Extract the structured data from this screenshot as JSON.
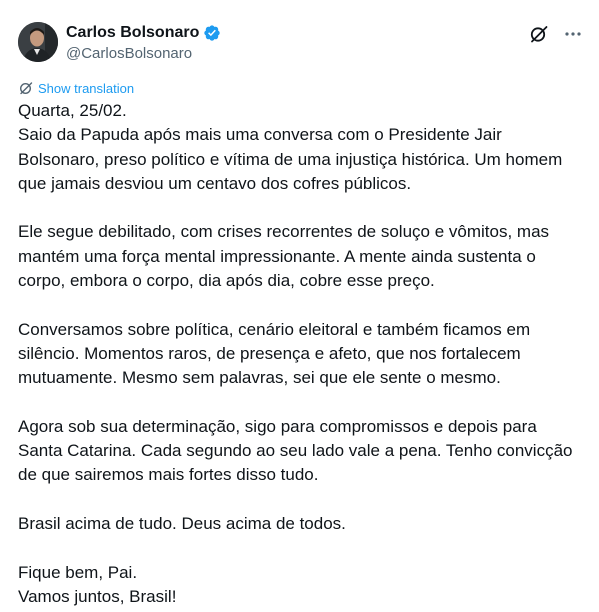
{
  "author": {
    "display_name": "Carlos Bolsonaro",
    "handle": "@CarlosBolsonaro",
    "verified": true
  },
  "icons": {
    "avatar": "avatar-photo",
    "verified": "verified-badge-icon",
    "grok": "grok-icon",
    "more": "more-options-icon",
    "translate": "translate-icon"
  },
  "colors": {
    "accent": "#1d9bf0",
    "text": "#0f1419",
    "secondary": "#536471"
  },
  "translation": {
    "label": "Show translation"
  },
  "post": {
    "paragraphs": [
      {
        "lines": [
          "Quarta, 25/02.",
          "Saio da Papuda após mais uma conversa com o Presidente Jair",
          "Bolsonaro, preso político e vítima de uma injustiça histórica. Um homem",
          "que jamais desviou um centavo dos cofres públicos."
        ]
      },
      {
        "lines": [
          "Ele segue debilitado, com crises recorrentes de soluço e vômitos, mas",
          "mantém uma força mental impressionante. A mente ainda sustenta o",
          "corpo, embora o corpo, dia após dia, cobre esse preço."
        ]
      },
      {
        "lines": [
          "Conversamos sobre política, cenário eleitoral e também ficamos em",
          "silêncio. Momentos raros, de presença e afeto, que nos fortalecem",
          "mutuamente. Mesmo sem palavras, sei que ele sente o mesmo."
        ]
      },
      {
        "lines": [
          "Agora sob sua determinação, sigo para compromissos e depois para",
          "Santa Catarina. Cada segundo ao seu lado vale a pena. Tenho convicção",
          "de que sairemos mais fortes disso tudo."
        ]
      },
      {
        "lines": [
          "Brasil acima de tudo. Deus acima de todos."
        ]
      },
      {
        "lines": [
          "Fique bem, Pai.",
          "Vamos juntos, Brasil!"
        ]
      }
    ]
  }
}
